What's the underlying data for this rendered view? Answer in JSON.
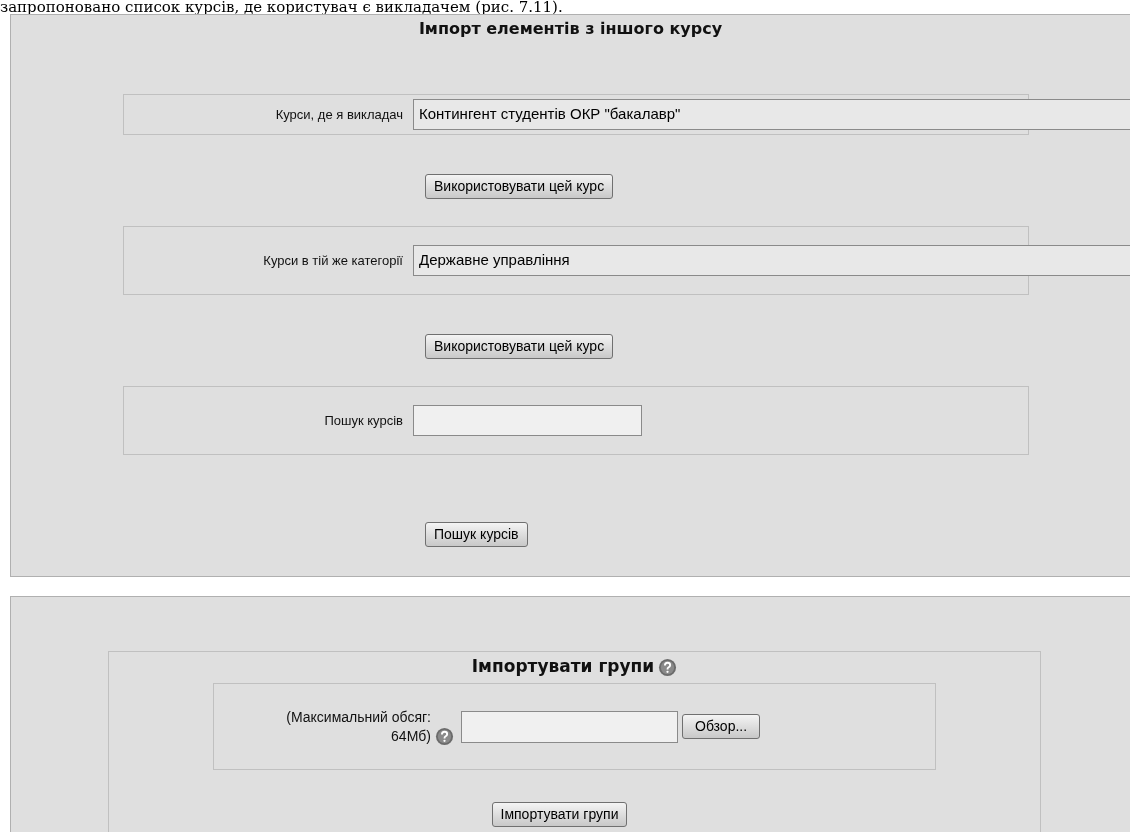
{
  "document_text": "запропоновано список курсів, де користувач є викладачем (рис. 7.11).",
  "import_from_course": {
    "title": "Імпорт елементів з іншого курсу",
    "sections": [
      {
        "kind": "select",
        "label": "Курси, де я викладач",
        "value": "Контингент студентів ОКР \"бакалавр\"",
        "button": "Використовувати цей курс"
      },
      {
        "kind": "select",
        "label": "Курси в тій же категорії",
        "value": "Державне управління",
        "button": "Використовувати цей курс"
      },
      {
        "kind": "search",
        "label": "Пошук курсів",
        "button": "Пошук курсів"
      }
    ]
  },
  "import_groups": {
    "title": "Імпортувати групи",
    "file_label": "(Максимальний обсяг: 64Мб)",
    "browse_button": "Обзор...",
    "button": "Імпортувати групи"
  }
}
